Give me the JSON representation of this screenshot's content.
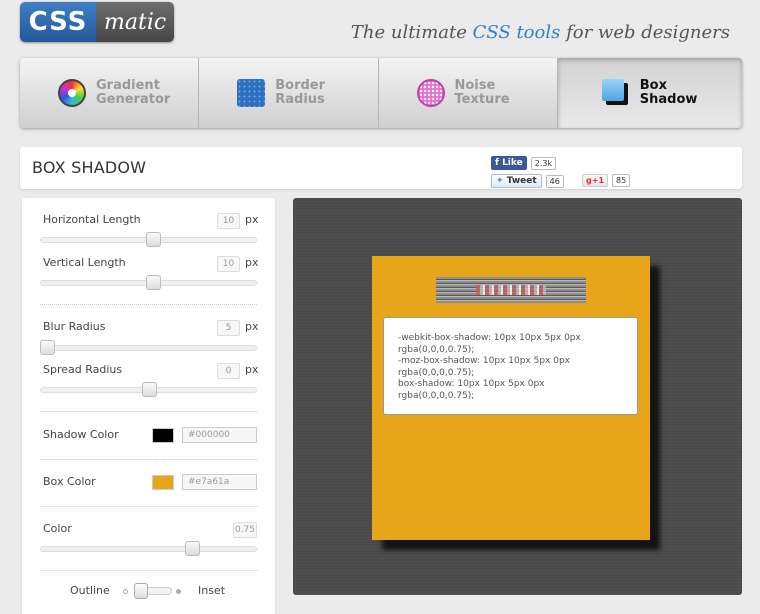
{
  "header": {
    "logo_css": "CSS",
    "logo_matic": "matic",
    "tagline_pre": "The ultimate ",
    "tagline_highlight": "CSS tools",
    "tagline_post": " for web designers"
  },
  "tabs": [
    {
      "line1": "Gradient",
      "line2": "Generator",
      "icon": "gradient-icon",
      "active": false
    },
    {
      "line1": "Border",
      "line2": "Radius",
      "icon": "border-radius-icon",
      "active": false
    },
    {
      "line1": "Noise",
      "line2": "Texture",
      "icon": "noise-icon",
      "active": false
    },
    {
      "line1": "Box",
      "line2": "Shadow",
      "icon": "box-shadow-icon",
      "active": true
    }
  ],
  "page_title": "BOX SHADOW",
  "social": {
    "like_label": "Like",
    "like_count": "2.3k",
    "tweet_label": "Tweet",
    "tweet_count": "46",
    "gplus_label": "+1",
    "gplus_count": "85"
  },
  "controls": {
    "horizontal_length": {
      "label": "Horizontal Length",
      "value": "10",
      "unit": "px",
      "level": 0.52
    },
    "vertical_length": {
      "label": "Vertical Length",
      "value": "10",
      "unit": "px",
      "level": 0.52
    },
    "blur_radius": {
      "label": "Blur Radius",
      "value": "5",
      "unit": "px",
      "level": 0.03
    },
    "spread_radius": {
      "label": "Spread Radius",
      "value": "0",
      "unit": "px",
      "level": 0.5
    },
    "shadow_color": {
      "label": "Shadow Color",
      "value": "#000000",
      "swatch": "#000000"
    },
    "box_color": {
      "label": "Box Color",
      "value": "#e7a61a",
      "swatch": "#e7a61a"
    },
    "opacity": {
      "label": "Color",
      "value": "0.75",
      "level": 0.7
    },
    "outline_label": "Outline",
    "inset_label": "Inset"
  },
  "preview": {
    "code": "-webkit-box-shadow: 10px 10px 5px 0px\nrgba(0,0,0,0.75);\n-moz-box-shadow: 10px 10px 5px 0px\nrgba(0,0,0,0.75);\nbox-shadow: 10px 10px 5px 0px\nrgba(0,0,0,0.75);"
  }
}
